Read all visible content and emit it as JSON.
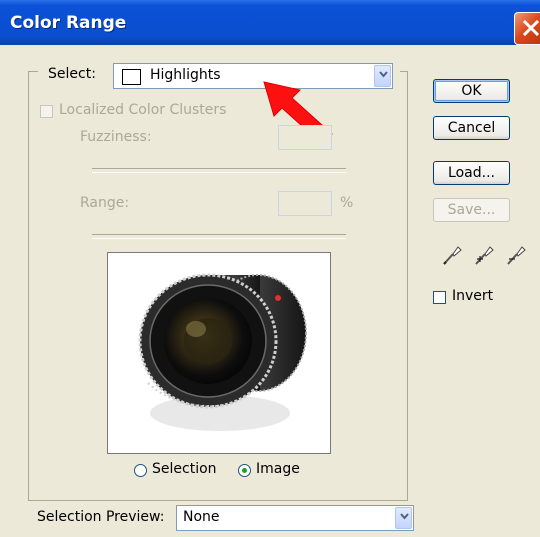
{
  "window": {
    "title": "Color Range"
  },
  "select": {
    "label": "Select:",
    "value": "Highlights"
  },
  "localized_clusters": {
    "label": "Localized Color Clusters",
    "checked": false,
    "enabled": false
  },
  "fuzziness": {
    "label": "Fuzziness:",
    "value": ""
  },
  "range": {
    "label": "Range:",
    "value": "",
    "unit": "%"
  },
  "preview_mode": {
    "options": [
      "Selection",
      "Image"
    ],
    "selected": "Image"
  },
  "selection_preview": {
    "label": "Selection Preview:",
    "value": "None"
  },
  "buttons": {
    "ok": "OK",
    "cancel": "Cancel",
    "load": "Load...",
    "save": "Save..."
  },
  "invert": {
    "label": "Invert",
    "checked": false
  },
  "colors": {
    "titlebar": "#0a4fd2",
    "dialog_bg": "#ece9d8",
    "annotation_arrow": "#ff0000",
    "radio_dot": "#21a121"
  }
}
